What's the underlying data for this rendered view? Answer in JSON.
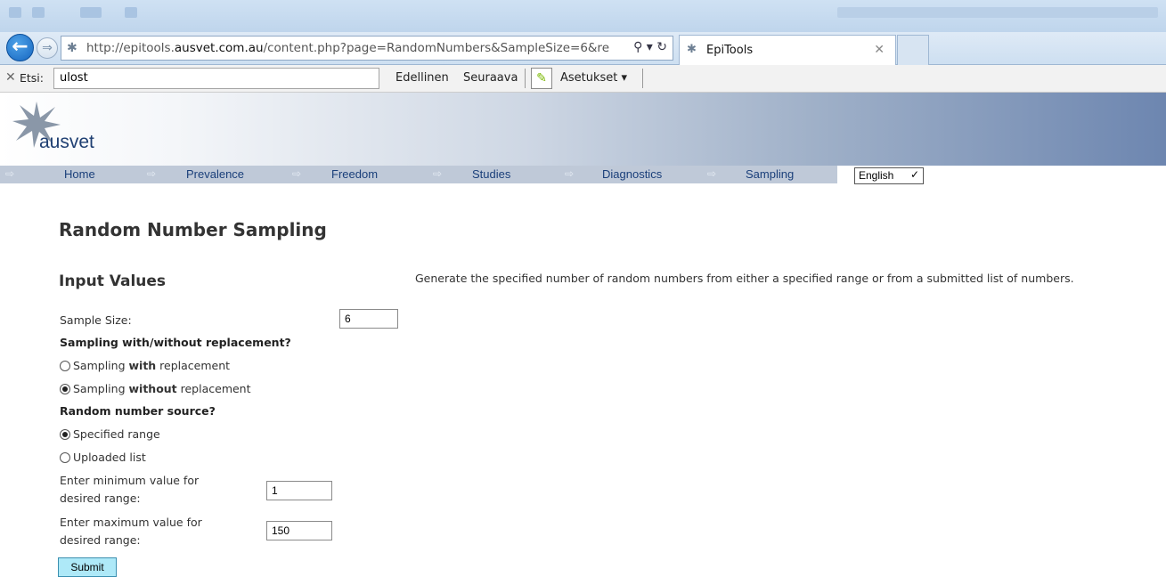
{
  "browser": {
    "url_prefix": "http://epitools.",
    "url_domain": "ausvet.com.au",
    "url_suffix": "/content.php?page=RandomNumbers&SampleSize=6&re",
    "tab_title": "EpiTools"
  },
  "findbar": {
    "label": "Etsi:",
    "query": "ulost",
    "previous": "Edellinen",
    "next": "Seuraava",
    "settings": "Asetukset"
  },
  "site": {
    "logo_text": "ausvet",
    "menu": [
      "Home",
      "Prevalence",
      "Freedom",
      "Studies",
      "Diagnostics",
      "Sampling"
    ],
    "language": "English"
  },
  "page": {
    "title": "Random Number Sampling",
    "section_title": "Input Values",
    "description": "Generate the specified number of random numbers from either a specified range or from a submitted list of numbers."
  },
  "form": {
    "sample_size_label": "Sample Size:",
    "sample_size_value": "6",
    "replacement_heading": "Sampling with/without replacement?",
    "with_prefix": "Sampling ",
    "with_bold": "with",
    "with_suffix": " replacement",
    "without_prefix": "Sampling ",
    "without_bold": "without",
    "without_suffix": " replacement",
    "source_heading": "Random number source?",
    "source_range": "Specified range",
    "source_list": "Uploaded list",
    "min_label_1": "Enter minimum value for",
    "min_label_2": "desired range:",
    "min_value": "1",
    "max_label_1": "Enter maximum value for",
    "max_label_2": "desired range:",
    "max_value": "150",
    "submit": "Submit"
  }
}
